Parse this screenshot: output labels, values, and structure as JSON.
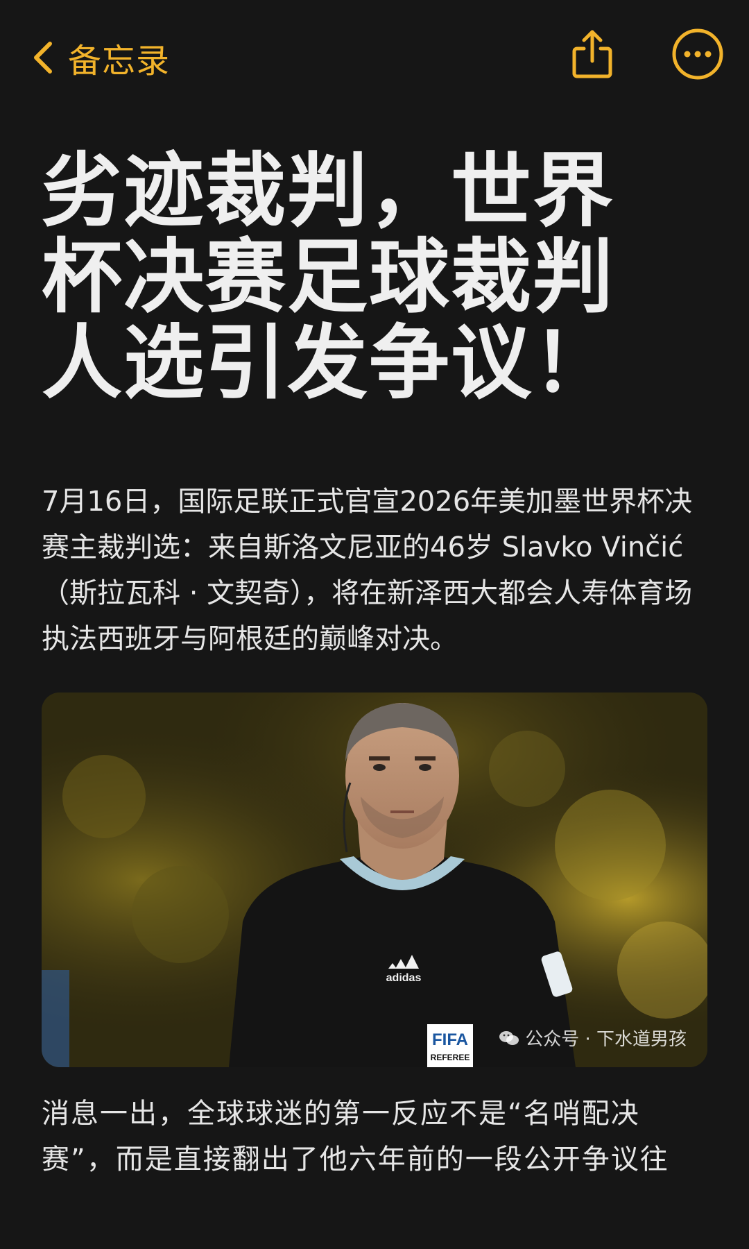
{
  "nav": {
    "back_label": "备忘录",
    "back_icon": "chevron-left-icon",
    "share_icon": "share-icon",
    "more_icon": "more-icon",
    "accent_color": "#f2b32b"
  },
  "note": {
    "title": "劣迹裁判，世界杯决赛足球裁判人选引发争议！",
    "paragraph1": "7月16日，国际足联正式官宣2026年美加墨世界杯决赛主裁判选：来自斯洛文尼亚的46岁 Slavko Vinčić（斯拉瓦科 · 文契奇），将在新泽西大都会人寿体育场执法西班牙与阿根廷的巅峰对决。",
    "photo": {
      "jersey_brand": "adidas",
      "badge_top": "FIFA",
      "badge_bottom": "REFEREE",
      "watermark": "公众号 · 下水道男孩",
      "watermark_icon": "wechat-icon"
    },
    "paragraph2": "消息一出，全球球迷的第一反应不是“名哨配决赛”，而是直接翻出了他六年前的一段公开争议往"
  }
}
